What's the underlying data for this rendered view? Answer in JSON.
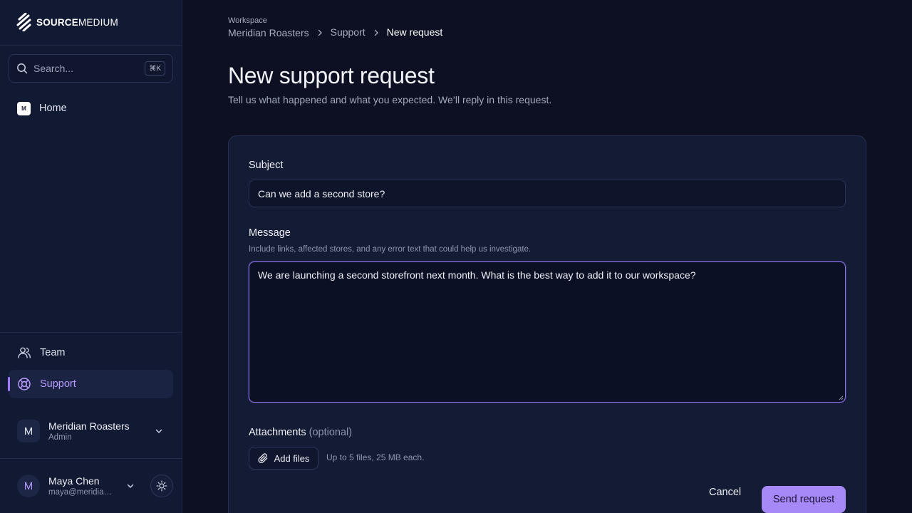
{
  "brand": {
    "bold": "SOURCE",
    "rest": "MEDIUM"
  },
  "search": {
    "placeholder": "Search...",
    "shortcut": "⌘K"
  },
  "nav": {
    "home": {
      "badge": "M",
      "label": "Home"
    },
    "team": {
      "label": "Team"
    },
    "support": {
      "label": "Support"
    }
  },
  "workspace_account": {
    "initial": "M",
    "name": "Meridian Roasters",
    "role": "Admin"
  },
  "user": {
    "initial": "M",
    "name": "Maya Chen",
    "email": "maya@meridianr..."
  },
  "breadcrumb": {
    "workspace_label": "Workspace",
    "workspace_name": "Meridian Roasters",
    "support": "Support",
    "current": "New request"
  },
  "page": {
    "title": "New support request",
    "subtitle": "Tell us what happened and what you expected. We’ll reply in this request."
  },
  "form": {
    "subject_label": "Subject",
    "subject_value": "Can we add a second store?",
    "message_label": "Message",
    "message_hint": "Include links, affected stores, and any error text that could help us investigate.",
    "message_value": "We are launching a second storefront next month. What is the best way to add it to our workspace?",
    "attachments_label": "Attachments",
    "attachments_optional": "(optional)",
    "add_files": "Add files",
    "files_hint": "Up to 5 files, 25 MB each.",
    "cancel": "Cancel",
    "send": "Send request"
  },
  "colors": {
    "accent": "#a688f7",
    "active_text": "#b79bff",
    "background": "#0c1022",
    "sidebar": "#121933"
  }
}
